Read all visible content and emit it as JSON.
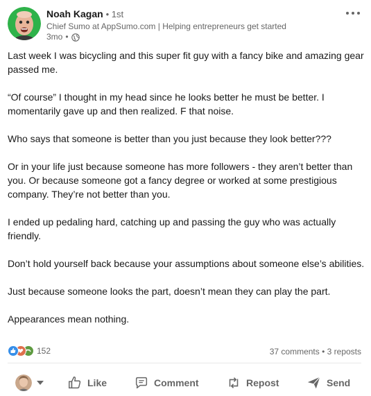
{
  "post": {
    "author": {
      "name": "Noah Kagan",
      "degree": "1st",
      "headline": "Chief Sumo at AppSumo.com | Helping entrepreneurs get started",
      "time": "3mo"
    },
    "paragraphs": [
      "Last week I was bicycling and this super fit guy with a fancy bike and amazing gear passed me.",
      "“Of course” I thought in my head since he looks better he must be better. I momentarily gave up and then realized. F that noise.",
      "Who says that someone is better than you just because they look better???",
      "Or in your life just because someone has more followers - they aren’t better than you. Or because someone got a fancy degree or worked at some prestigious company. They’re not better than you.",
      "I ended up pedaling hard, catching up and passing the guy who was actually friendly.",
      "Don’t hold yourself back because your assumptions about someone else’s abilities.",
      "Just because someone looks the part, doesn’t mean they can play the part.",
      "Appearances mean nothing."
    ],
    "social": {
      "reaction_count": "152",
      "comments": "37 comments",
      "reposts": "3 reposts",
      "reaction_icons": [
        "like-icon",
        "love-icon",
        "support-icon"
      ]
    },
    "actions": {
      "like": "Like",
      "comment": "Comment",
      "repost": "Repost",
      "send": "Send"
    }
  },
  "colors": {
    "avatar_bg": "#2fb24a",
    "text_secondary": "#666666",
    "divider": "#e8e8e8",
    "like_blue": "#378fe9",
    "love_red": "#df704d",
    "support_green": "#5f9b41"
  }
}
